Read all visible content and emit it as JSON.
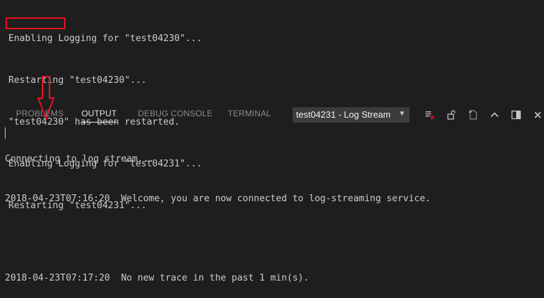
{
  "terminal_top": {
    "lines": [
      "Enabling Logging for \"test04230\"...",
      "Restarting \"test04230\"...",
      "\"test04230\" has been restarted.",
      "Enabling Logging for \"test04231\"...",
      "Restarting \"test04231\"..."
    ]
  },
  "annotation": {
    "highlight_color": "#e81123"
  },
  "panel": {
    "tabs": [
      {
        "label": "PROBLEMS",
        "active": false
      },
      {
        "label": "OUTPUT",
        "active": true
      },
      {
        "label": "DEBUG CONSOLE",
        "active": false
      },
      {
        "label": "TERMINAL",
        "active": false
      }
    ],
    "channel_select": {
      "value": "test04231 - Log Stream"
    },
    "icons": [
      "clear-output-icon",
      "lock-scroll-icon",
      "open-log-file-icon",
      "maximize-panel-icon",
      "split-panel-icon",
      "close-icon"
    ]
  },
  "output": {
    "lines": [
      "Connecting to log stream...",
      "2018-04-23T07:16:20  Welcome, you are now connected to log-streaming service.",
      "",
      "2018-04-23T07:17:20  No new trace in the past 1 min(s)."
    ]
  }
}
